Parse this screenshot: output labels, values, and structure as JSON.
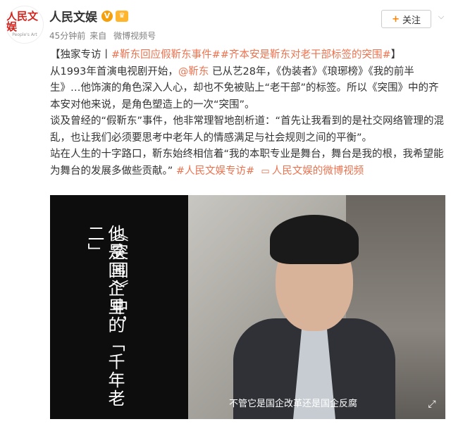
{
  "account": {
    "name": "人民文娱",
    "logo_text": "人民文娱",
    "logo_sub": "People's Art",
    "meta_time": "45分钟前",
    "meta_source_prefix": "来自",
    "meta_source": "微博视频号"
  },
  "follow_button": {
    "label": "关注",
    "plus": "+"
  },
  "post": {
    "line1_prefix": "【独家专访丨",
    "line1_tag1": "#靳东回应假靳东事件#",
    "line1_tag2": "#齐本安是靳东对老干部标签的突围#",
    "line1_suffix": "】",
    "para1_a": "从1993年首演电视剧开始，",
    "para1_mention": "@靳东",
    "para1_b": " 已从艺28年，《伪装者》《琅琊榜》《我的前半生》…他饰演的角色深入人心，却也不免被贴上“老干部”的标签。所以《突围》中的齐本安对他来说，是角色塑造上的一次“突围”。",
    "para2": "谈及曾经的“假靳东”事件，他非常理智地剖析道：“首先让我看到的是社交网络管理的混乱，也让我们必须要思考中老年人的情感满足与社会规则之间的平衡”。",
    "para3_a": "站在人生的十字路口，靳东始终相信着“我的本职专业是舞台，舞台是我的根，我希望能为舞台的发展多做些贡献。” ",
    "para3_tag": "#人民文娱专访#",
    "para3_link": "人民文娱的微博视频"
  },
  "video": {
    "vertical_line1": "《突围》中，",
    "vertical_line2": "他是国企里的「千年老二」",
    "subtitle": "不管它是国企改革还是国企反腐"
  },
  "colors": {
    "accent": "#eb7350",
    "follow_plus": "#ff8200",
    "verified": "#f59f0b"
  },
  "icons": [
    "verified-icon",
    "vip-icon",
    "chevron-down-icon",
    "video-link-icon",
    "fullscreen-icon"
  ]
}
